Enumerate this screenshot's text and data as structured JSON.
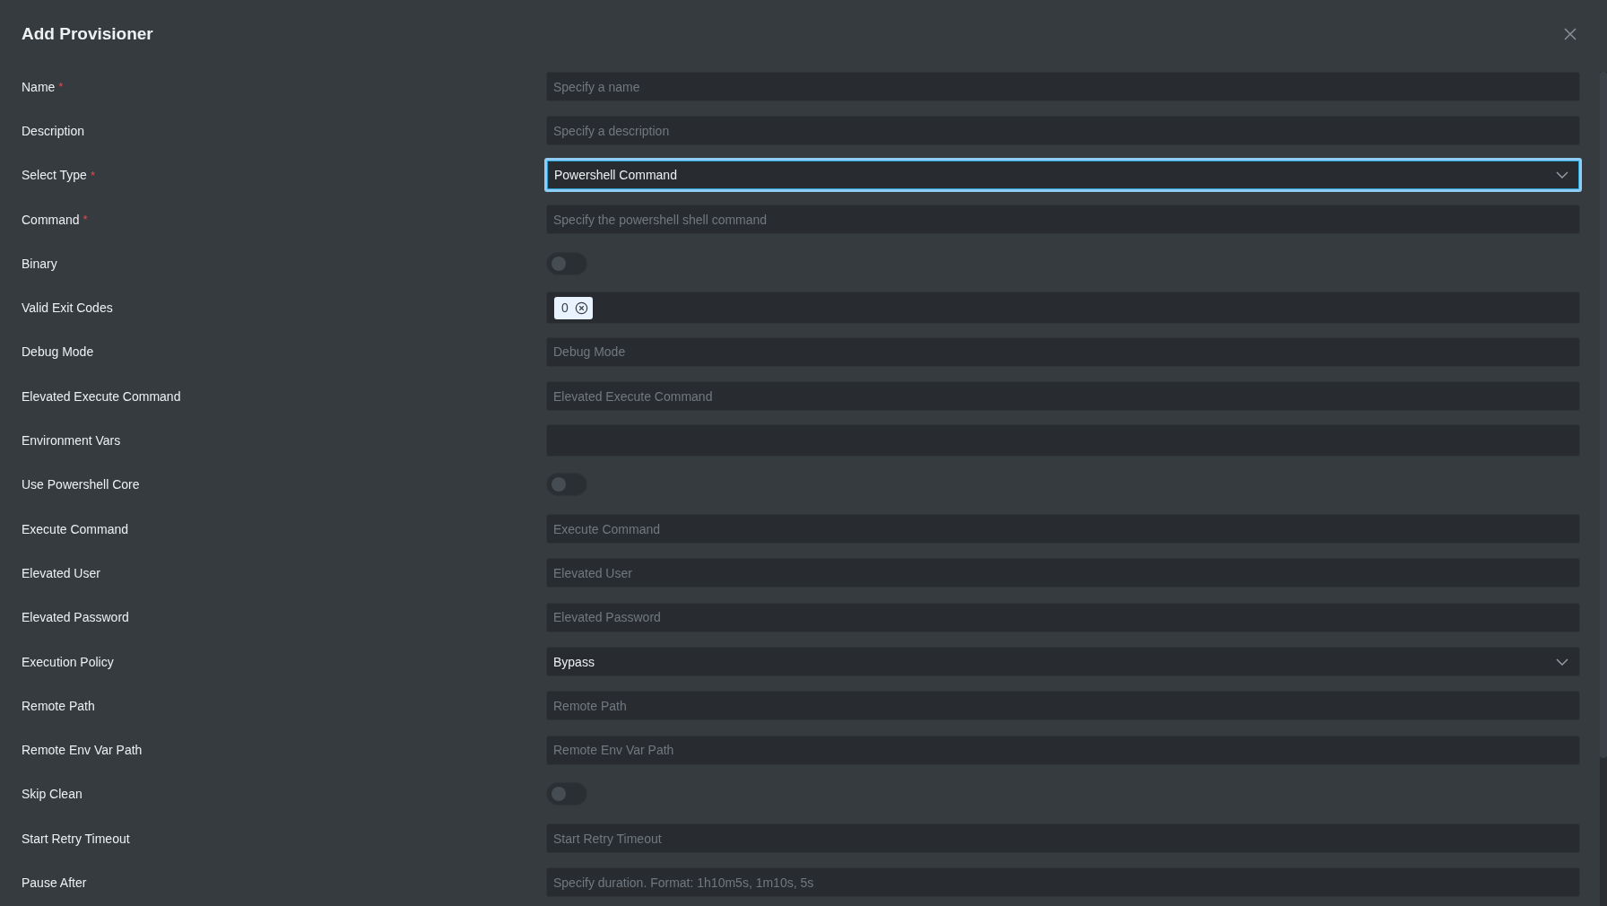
{
  "dialog": {
    "title": "Add Provisioner"
  },
  "fields": [
    {
      "label": "Name",
      "required_mark": "*",
      "kind": "text",
      "placeholder": "Specify a name"
    },
    {
      "label": "Description",
      "kind": "text",
      "placeholder": "Specify a description"
    },
    {
      "label": "Select Type",
      "required_mark": "*",
      "kind": "select",
      "value": "Powershell Command",
      "focused": true
    },
    {
      "label": "Command",
      "required_mark": "*",
      "kind": "text",
      "placeholder": "Specify the powershell shell command"
    },
    {
      "label": "Binary",
      "kind": "toggle",
      "on": false
    },
    {
      "label": "Valid Exit Codes",
      "kind": "tags",
      "tags": [
        "0"
      ]
    },
    {
      "label": "Debug Mode",
      "kind": "text",
      "placeholder": "Debug Mode"
    },
    {
      "label": "Elevated Execute Command",
      "kind": "text",
      "placeholder": "Elevated Execute Command"
    },
    {
      "label": "Environment Vars",
      "kind": "tags"
    },
    {
      "label": "Use Powershell Core",
      "kind": "toggle",
      "on": false
    },
    {
      "label": "Execute Command",
      "kind": "text",
      "placeholder": "Execute Command"
    },
    {
      "label": "Elevated User",
      "kind": "text",
      "placeholder": "Elevated User"
    },
    {
      "label": "Elevated Password",
      "kind": "text",
      "placeholder": "Elevated Password"
    },
    {
      "label": "Execution Policy",
      "kind": "select",
      "value": "Bypass",
      "focused": false
    },
    {
      "label": "Remote Path",
      "kind": "text",
      "placeholder": "Remote Path"
    },
    {
      "label": "Remote Env Var Path",
      "kind": "text",
      "placeholder": "Remote Env Var Path"
    },
    {
      "label": "Skip Clean",
      "kind": "toggle",
      "on": false
    },
    {
      "label": "Start Retry Timeout",
      "kind": "text",
      "placeholder": "Start Retry Timeout"
    },
    {
      "label": "Pause After",
      "kind": "text",
      "placeholder": "Specify duration. Format: 1h10m5s, 1m10s, 5s"
    }
  ]
}
